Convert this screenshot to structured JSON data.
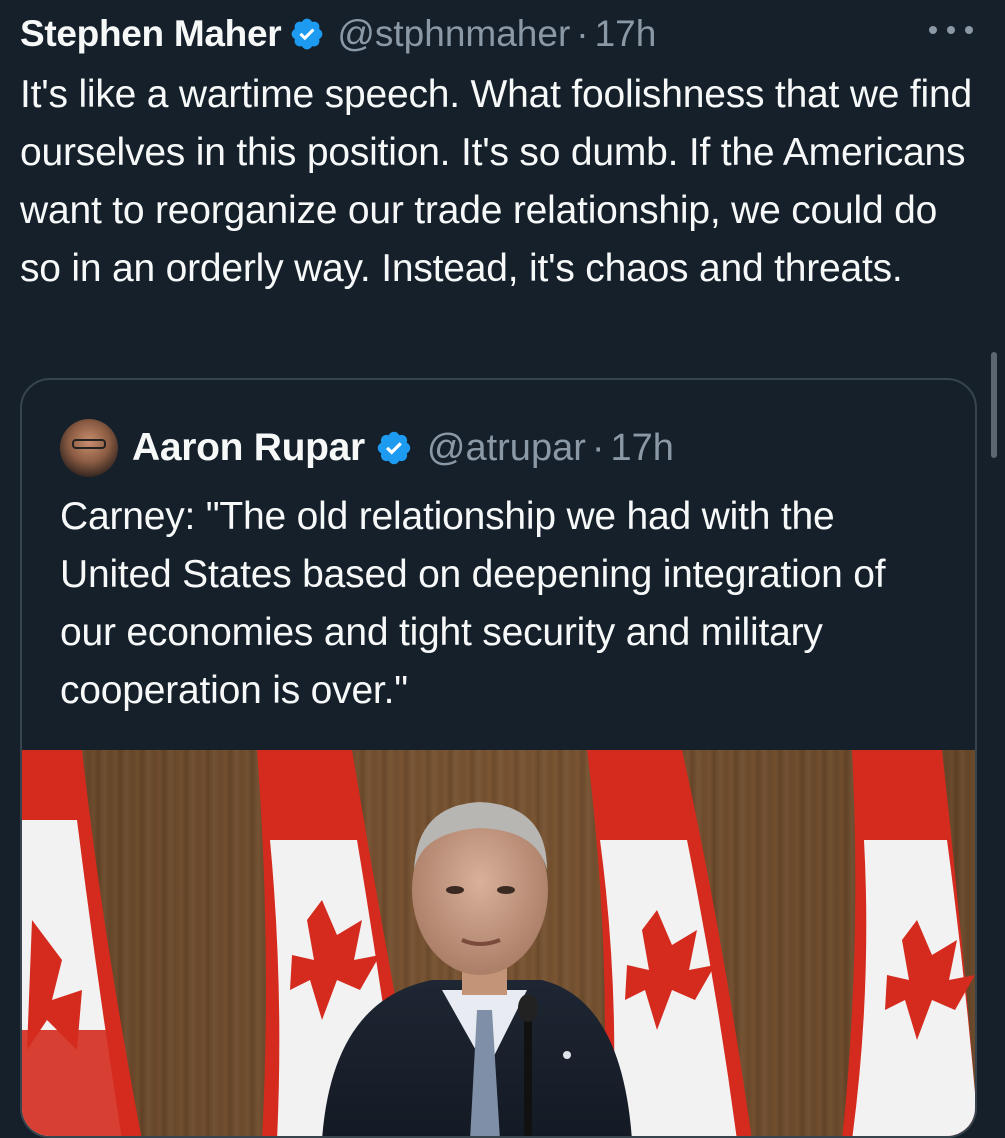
{
  "tweet": {
    "author_name": "Stephen Maher",
    "author_handle": "@stphnmaher",
    "separator": "·",
    "time": "17h",
    "text": "It's like a wartime speech. What foolishness that we find ourselves in this position. It's so dumb. If the Americans want to reorganize our trade relationship, we could do so in an orderly way. Instead, it's chaos and threats."
  },
  "quoted_tweet": {
    "author_name": "Aaron Rupar",
    "author_handle": "@atrupar",
    "separator": "·",
    "time": "17h",
    "text": "Carney: \"The old relationship we had with the United States based on deepening integration of our economies and tight security and military cooperation is over.\""
  },
  "icons": {
    "verified": "verified-badge-icon",
    "more": "more-options-icon"
  },
  "colors": {
    "background": "#15202b",
    "primary_text": "#f7f9f9",
    "secondary_text": "#8b98a5",
    "verified": "#1d9bf0",
    "border": "#38444d",
    "flag_red": "#d52b1e"
  }
}
